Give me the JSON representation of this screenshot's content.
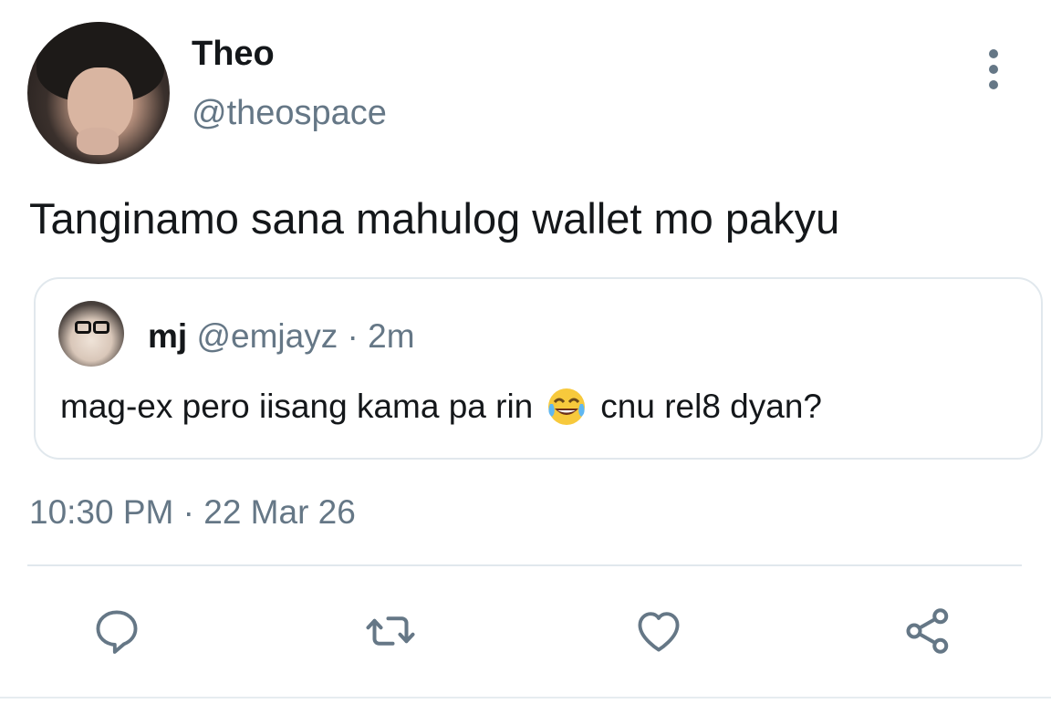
{
  "tweet": {
    "author": {
      "display_name": "Theo",
      "handle": "@theospace"
    },
    "text": "Tanginamo sana mahulog wallet mo pakyu",
    "timestamp": "10:30 PM · 22 Mar 26",
    "more_icon": "more-vertical-icon"
  },
  "quote": {
    "display_name": "mj",
    "handle": "@emjayz",
    "separator": " · ",
    "time_ago": "2m",
    "text_before_emoji": "mag-ex pero iisang kama pa rin",
    "emoji": "face-with-tears-of-joy",
    "text_after_emoji": "cnu rel8 dyan?"
  },
  "actions": [
    {
      "icon": "reply-icon"
    },
    {
      "icon": "retweet-icon"
    },
    {
      "icon": "heart-icon"
    },
    {
      "icon": "share-icon"
    }
  ],
  "colors": {
    "primary_text": "#14171a",
    "secondary_text": "#657786",
    "border": "#e1e8ed",
    "background": "#ffffff"
  }
}
